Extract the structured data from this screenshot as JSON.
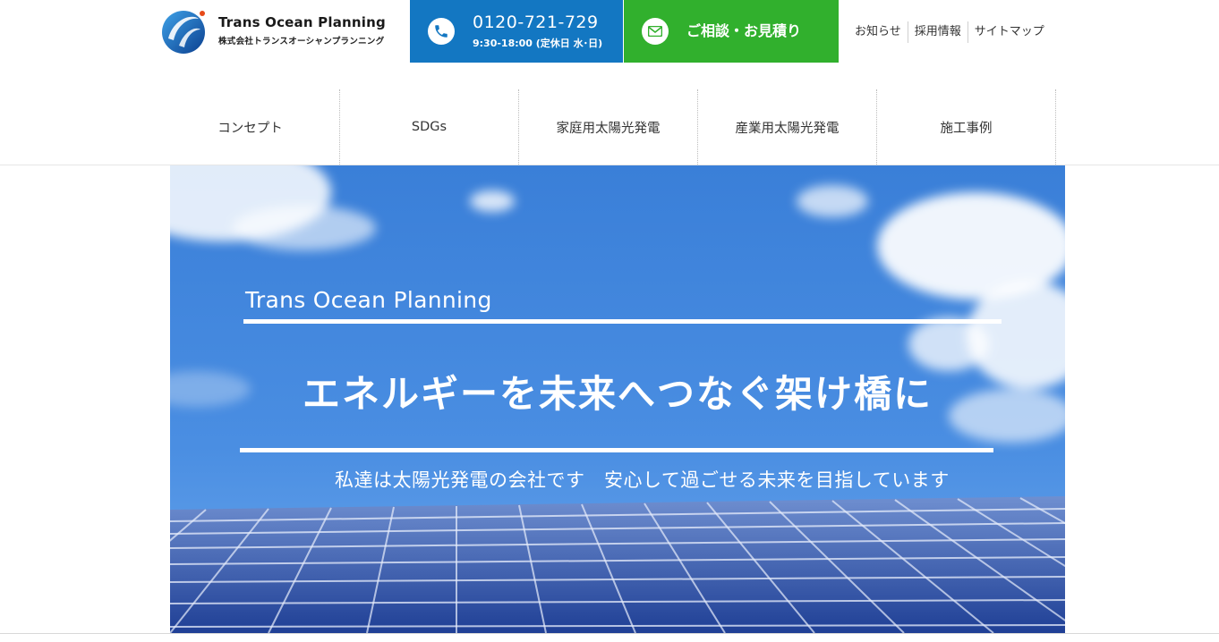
{
  "header": {
    "logo": {
      "name": "Trans Ocean Planning",
      "kana": "株式会社トランスオーシャンプランニング",
      "icon": "globe-swoosh-logo"
    },
    "tel": {
      "icon": "phone-icon",
      "number": "0120-721-729",
      "hours": "9:30-18:00 (定休日 水･日)"
    },
    "contact": {
      "icon": "mail-icon",
      "label": "ご相談・お見積り"
    },
    "util_nav": [
      "お知らせ",
      "採用情報",
      "サイトマップ"
    ]
  },
  "global_nav": [
    "コンセプト",
    "SDGs",
    "家庭用太陽光発電",
    "産業用太陽光発電",
    "施工事例"
  ],
  "hero": {
    "brand": "Trans Ocean Planning",
    "headline": "エネルギーを未来へつなぐ架け橋に",
    "subtitle": "私達は太陽光発電の会社です　安心して過ごせる未来を目指しています"
  },
  "colors": {
    "tel_bg": "#1377c2",
    "contact_bg": "#31b02d",
    "sky": "#3f83dc"
  }
}
